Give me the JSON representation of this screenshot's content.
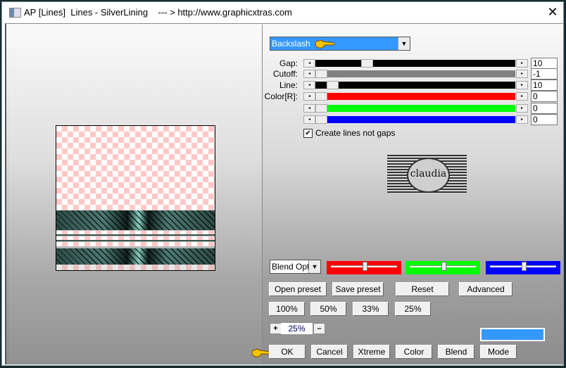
{
  "window": {
    "title": "AP [Lines]  Lines - SilverLining    --- > http://www.graphicxtras.com",
    "close_label": "✕"
  },
  "controls": {
    "mode_dropdown": {
      "value": "Backslash"
    },
    "sliders": [
      {
        "label": "Gap:",
        "value": "10",
        "track_color": "#000000",
        "position": 0.24
      },
      {
        "label": "Cutoff:",
        "value": "-1",
        "track_color": "#808080",
        "position": 0.0
      },
      {
        "label": "Line:",
        "value": "10",
        "track_color": "#000000",
        "position": 0.06
      },
      {
        "label": "Color[R]:",
        "value": "0",
        "track_color": "#ff0000",
        "position": 0.0
      },
      {
        "label": "",
        "value": "0",
        "track_color": "#00ff00",
        "position": 0.0
      },
      {
        "label": "",
        "value": "0",
        "track_color": "#0000ff",
        "position": 0.0
      }
    ],
    "checkbox": {
      "label": "Create lines not gaps",
      "checked": true,
      "mark": "✔"
    },
    "logo_text": "claudia",
    "blend_options": {
      "value": "Blend Options"
    },
    "color_sliders": [
      {
        "color": "#ff0000",
        "position": 0.5
      },
      {
        "color": "#00ff00",
        "position": 0.5
      },
      {
        "color": "#0000ff",
        "position": 0.5
      }
    ],
    "preset_buttons": [
      "Open preset",
      "Save preset",
      "Reset",
      "Advanced"
    ],
    "zoom_buttons": [
      "100%",
      "50%",
      "33%",
      "25%"
    ],
    "zoom": {
      "plus": "+",
      "value": "25%",
      "minus": "–"
    },
    "swatch_color": "#3399ff",
    "action_buttons": [
      "OK",
      "Cancel",
      "Xtreme",
      "Color",
      "Blend",
      "Mode"
    ]
  },
  "icons": {
    "arrow_left": "◂",
    "arrow_right": "▸",
    "dropdown": "▼"
  }
}
